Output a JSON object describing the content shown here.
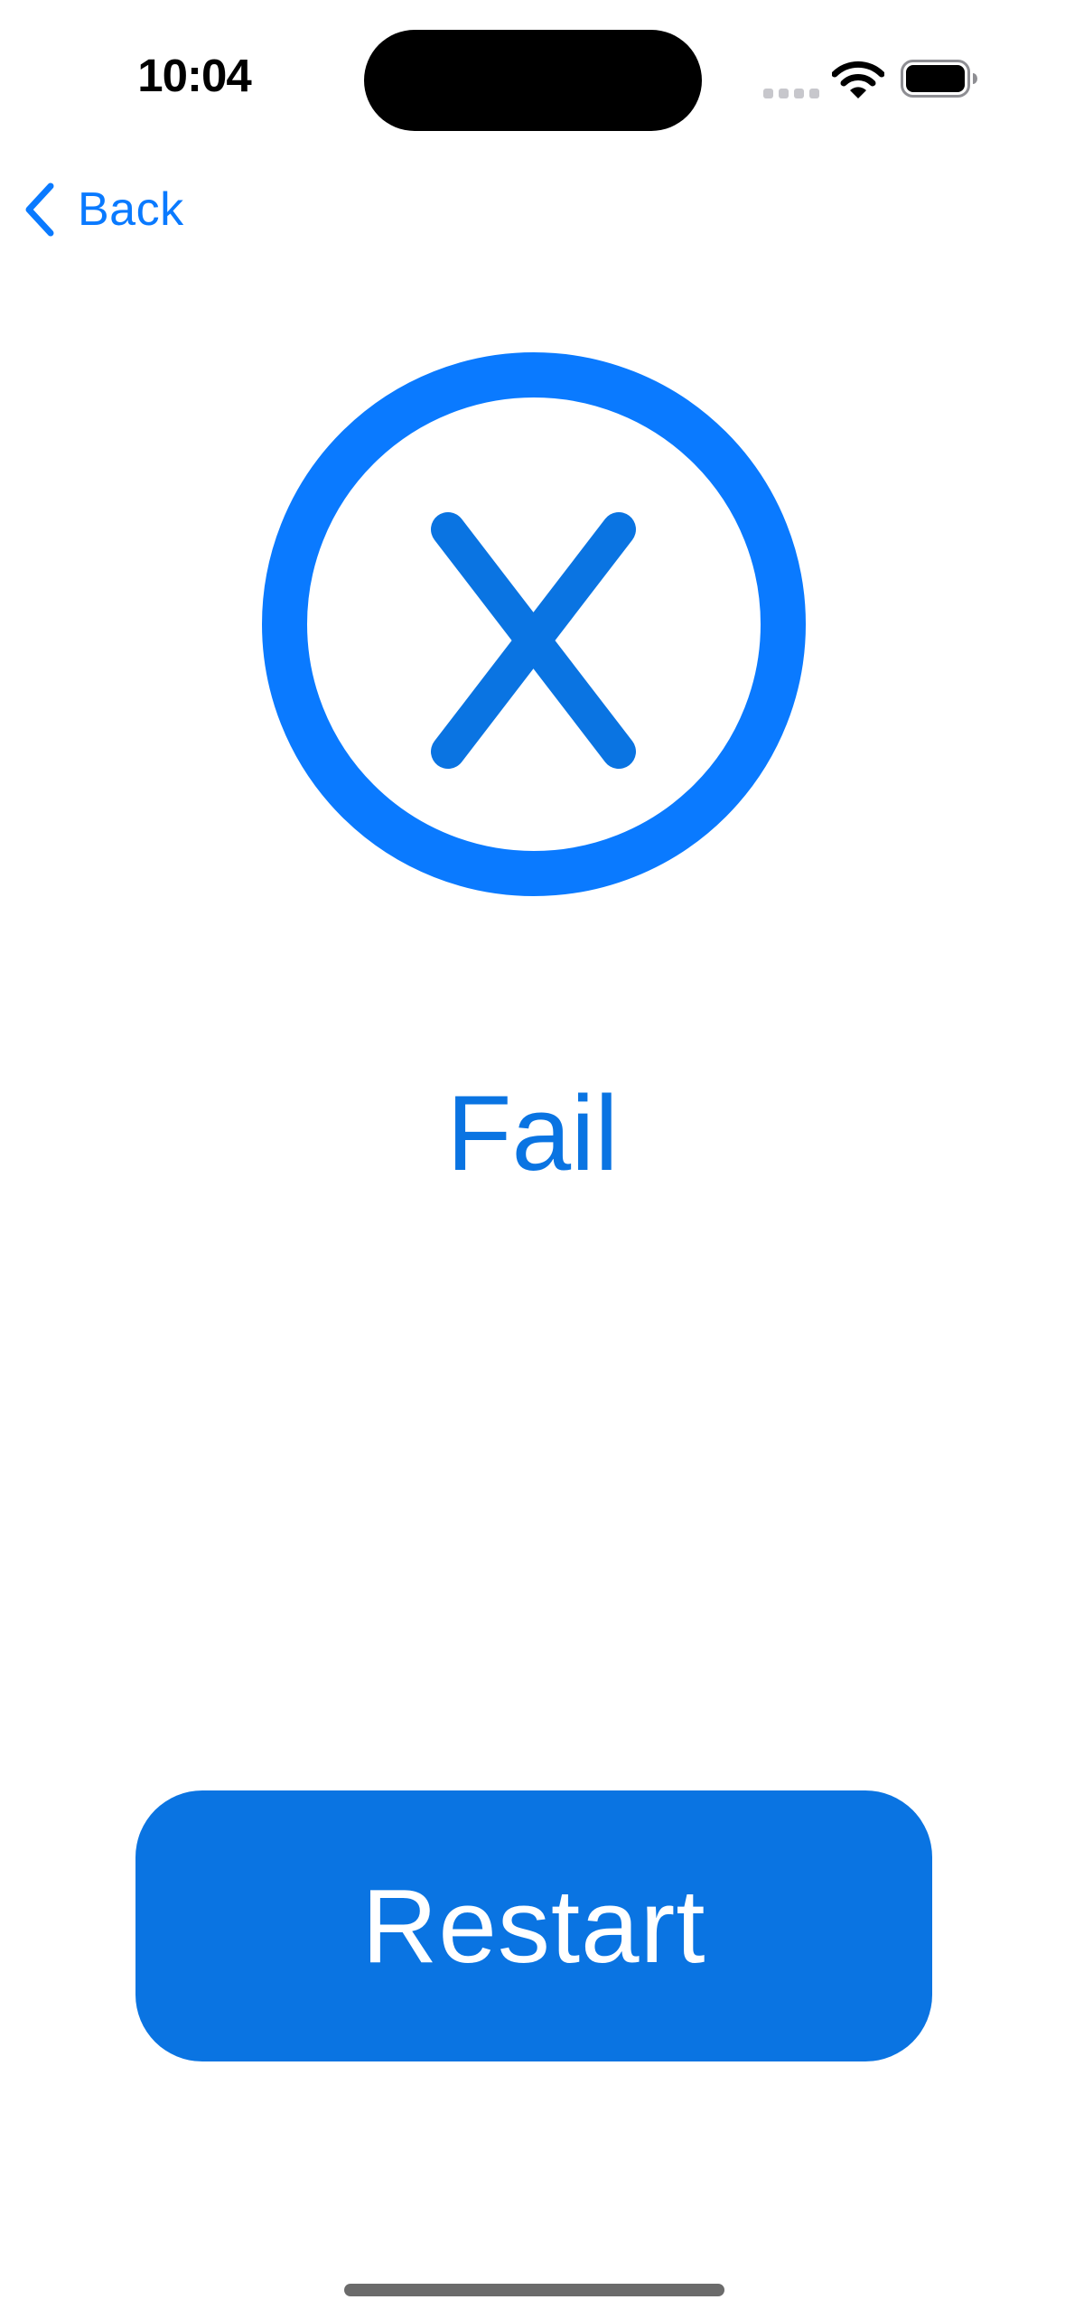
{
  "status_bar": {
    "time": "10:04",
    "signal_icon": "cellular-signal-icon",
    "wifi_icon": "wifi-icon",
    "battery_icon": "battery-icon"
  },
  "nav": {
    "back_label": "Back",
    "back_icon": "chevron-left-icon"
  },
  "result": {
    "icon": "xmark-circle-icon",
    "text": "Fail"
  },
  "actions": {
    "restart_label": "Restart"
  },
  "colors": {
    "accent": "#0a7aff",
    "button": "#0a74e2",
    "button_text": "#ffffff",
    "background": "#ffffff"
  }
}
